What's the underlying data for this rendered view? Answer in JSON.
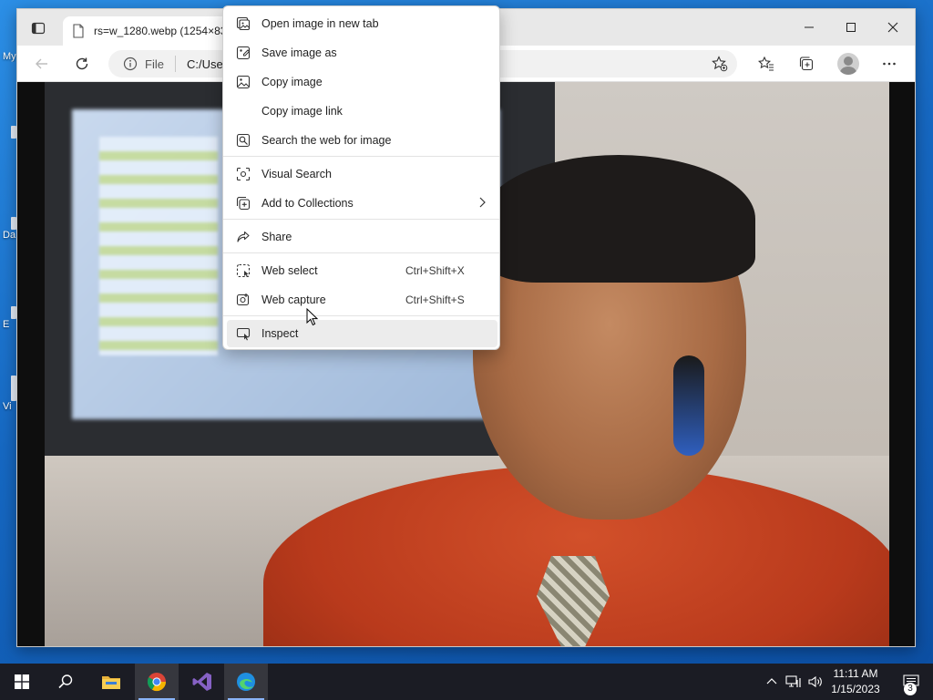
{
  "desktop": {
    "icons": [
      {
        "label": "My",
        "top": 0
      },
      {
        "label": "Da",
        "top": 0
      },
      {
        "label": "E",
        "top": 0
      },
      {
        "label": "Vi",
        "top": 0
      }
    ]
  },
  "browser": {
    "tab_title": "rs=w_1280.webp (1254×836)",
    "address": {
      "scheme_label": "File",
      "url": "C:/Use"
    }
  },
  "context_menu": {
    "items": [
      {
        "label": "Open image in new tab",
        "icon": "new-tab-icon"
      },
      {
        "label": "Save image as",
        "icon": "save-image-icon"
      },
      {
        "label": "Copy image",
        "icon": "copy-image-icon"
      },
      {
        "label": "Copy image link",
        "icon": ""
      },
      {
        "label": "Search the web for image",
        "icon": "image-search-icon"
      },
      {
        "label": "Visual Search",
        "icon": "visual-search-icon"
      },
      {
        "label": "Add to Collections",
        "icon": "collections-icon"
      },
      {
        "label": "Share",
        "icon": "share-icon"
      },
      {
        "label": "Web select",
        "shortcut": "Ctrl+Shift+X",
        "icon": "web-select-icon"
      },
      {
        "label": "Web capture",
        "shortcut": "Ctrl+Shift+S",
        "icon": "web-capture-icon"
      },
      {
        "label": "Inspect",
        "icon": "inspect-icon"
      }
    ]
  },
  "taskbar": {
    "time": "11:11 AM",
    "date": "1/15/2023",
    "notification_count": "3"
  },
  "colors": {
    "taskbar": "#1b1c24",
    "desktop": "#1668c2",
    "menu_hover": "#ececec"
  }
}
